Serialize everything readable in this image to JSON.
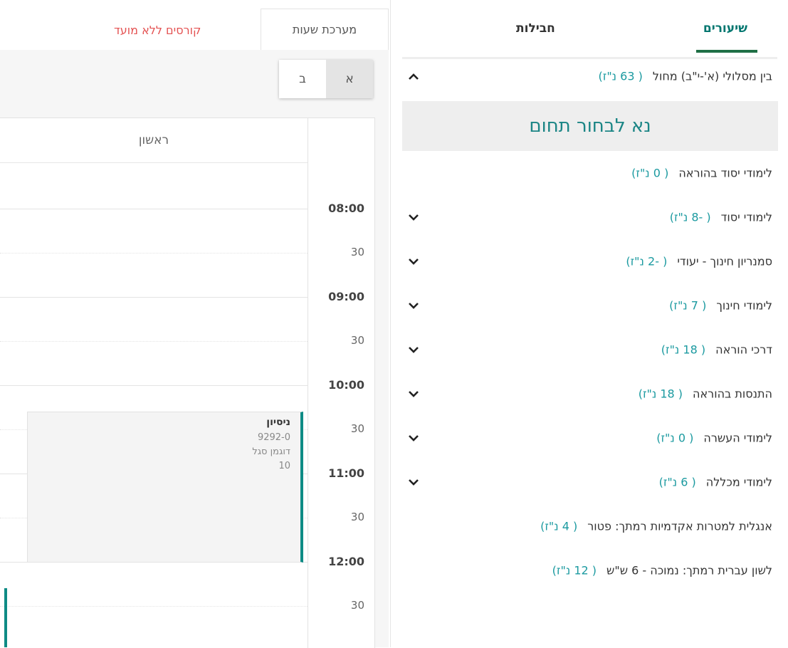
{
  "tabs": {
    "lessons_label": "שיעורים",
    "packages_label": "חבילות"
  },
  "categories": [
    {
      "label": "בין מסלולי (א'-י\"ב) מחול",
      "credits": "( 63 נ\"ז)",
      "chevron": "up"
    },
    {
      "label": "לימודי יסוד בהוראה",
      "credits": "( 0 נ\"ז)",
      "chevron": "none"
    },
    {
      "label": "לימודי יסוד",
      "credits": "( -8 נ\"ז)",
      "chevron": "down"
    },
    {
      "label": "סמנריון חינוך - יעודי",
      "credits": "( -2 נ\"ז)",
      "chevron": "down"
    },
    {
      "label": "לימודי חינוך",
      "credits": "( 7 נ\"ז)",
      "chevron": "down"
    },
    {
      "label": "דרכי הוראה",
      "credits": "( 18 נ\"ז)",
      "chevron": "down"
    },
    {
      "label": "התנסות בהוראה",
      "credits": "( 18 נ\"ז)",
      "chevron": "down"
    },
    {
      "label": "לימודי העשרה",
      "credits": "( 0 נ\"ז)",
      "chevron": "down"
    },
    {
      "label": "לימודי מכללה",
      "credits": "( 6 נ\"ז)",
      "chevron": "down"
    },
    {
      "label": "אנגלית למטרות אקדמיות רמתך: פטור",
      "credits": "( 4 נ\"ז)",
      "chevron": "none"
    },
    {
      "label": "לשון עברית רמתך: נמוכה - 6 ש\"ש",
      "credits": "( 12 נ\"ז)",
      "chevron": "none"
    }
  ],
  "choose_domain": "נא לבחור תחום",
  "view_tabs": {
    "schedule": "מערכת שעות",
    "no_date_courses": "קורסים ללא מועד"
  },
  "semesters": {
    "a": "א",
    "b": "ב",
    "selected": "א"
  },
  "calendar": {
    "day": "ראשון",
    "time_labels": [
      "08:00",
      "30",
      "09:00",
      "30",
      "10:00",
      "30",
      "11:00",
      "30",
      "12:00",
      "30"
    ]
  },
  "event": {
    "title": "ניסיון",
    "code": "9292-0",
    "lecturer": "דוגמן סגל",
    "room": "10"
  },
  "colors": {
    "accent": "#00766f",
    "credits": "#1b9aa0",
    "event_border": "#0e8b85",
    "no_date_tab": "#e45353"
  }
}
